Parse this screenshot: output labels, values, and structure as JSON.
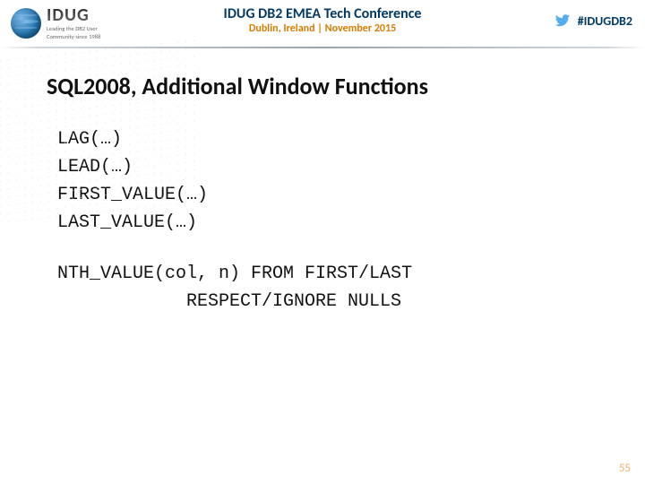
{
  "header": {
    "logo_name": "IDUG",
    "logo_tag1": "Leading the DB2 User",
    "logo_tag2": "Community since 1988",
    "conf_title": "IDUG DB2 EMEA Tech Conference",
    "conf_loc": "Dublin, Ireland  |  November 2015",
    "hashtag": "#IDUGDB2"
  },
  "slide": {
    "title": "SQL2008, Additional Window Functions",
    "funcs": {
      "lag": "LAG(…)",
      "lead": "LEAD(…)",
      "first": "FIRST_VALUE(…)",
      "last": "LAST_VALUE(…)"
    },
    "nth": {
      "line1": "NTH_VALUE(col, n) FROM FIRST/LAST",
      "line2": "RESPECT/IGNORE NULLS"
    }
  },
  "page_number": "55"
}
